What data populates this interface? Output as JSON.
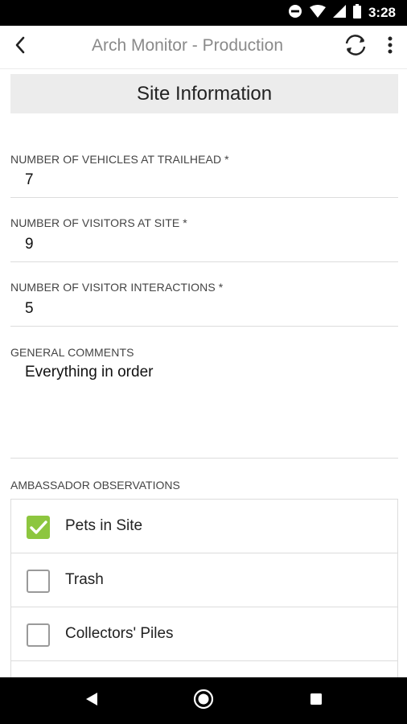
{
  "status_bar": {
    "time": "3:28",
    "icons": [
      "do-not-disturb-icon",
      "wifi-icon",
      "cell-signal-icon",
      "battery-icon"
    ]
  },
  "app_bar": {
    "title": "Arch Monitor - Production",
    "back_icon": "chevron-left-icon",
    "sync_icon": "sync-icon",
    "more_icon": "more-vert-icon"
  },
  "section": {
    "title": "Site Information"
  },
  "fields": [
    {
      "label": "NUMBER OF VEHICLES AT TRAILHEAD *",
      "value": "7"
    },
    {
      "label": "NUMBER OF VISITORS AT SITE *",
      "value": "9"
    },
    {
      "label": "NUMBER OF VISITOR INTERACTIONS *",
      "value": "5"
    },
    {
      "label": "GENERAL COMMENTS",
      "value": "Everything in order"
    }
  ],
  "observations": {
    "label": "AMBASSADOR OBSERVATIONS",
    "items": [
      {
        "label": "Pets in Site",
        "checked": true
      },
      {
        "label": "Trash",
        "checked": false
      },
      {
        "label": "Collectors' Piles",
        "checked": false
      }
    ]
  },
  "colors": {
    "checkbox_checked": "#8dc63f",
    "section_header_bg": "#ececec",
    "title_gray": "#8a8a8a"
  },
  "nav_bar": {
    "icons": [
      "back-triangle-icon",
      "home-circle-icon",
      "recents-square-icon"
    ]
  }
}
